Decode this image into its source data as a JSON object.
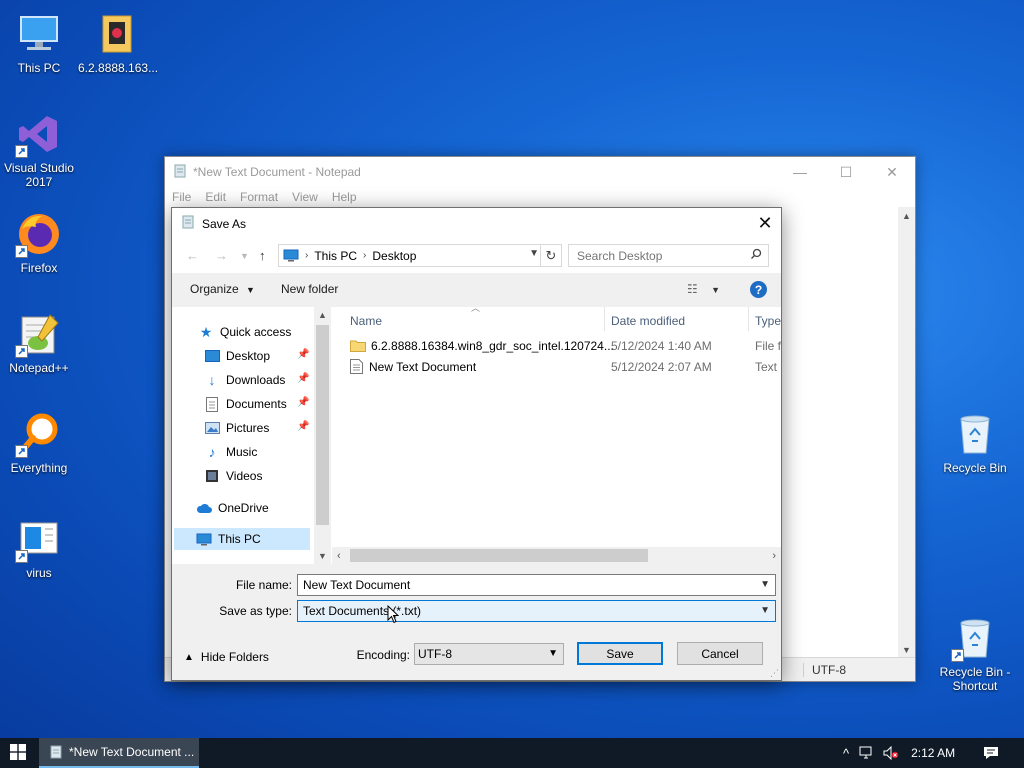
{
  "desktop": {
    "icons": [
      {
        "label": "This PC"
      },
      {
        "label": "6.2.8888.163..."
      },
      {
        "label": "Visual Studio 2017"
      },
      {
        "label": "Firefox"
      },
      {
        "label": "Notepad++"
      },
      {
        "label": "Everything"
      },
      {
        "label": "virus"
      },
      {
        "label": "Recycle Bin"
      },
      {
        "label": "Recycle Bin - Shortcut"
      }
    ]
  },
  "notepad": {
    "title": "*New Text Document - Notepad",
    "menu": [
      "File",
      "Edit",
      "Format",
      "View",
      "Help"
    ],
    "status_encoding": "UTF-8"
  },
  "dialog": {
    "title": "Save As",
    "breadcrumb": [
      "This PC",
      "Desktop"
    ],
    "search_placeholder": "Search Desktop",
    "organize_label": "Organize",
    "new_folder_label": "New folder",
    "nav": {
      "quick_access": "Quick access",
      "desktop": "Desktop",
      "downloads": "Downloads",
      "documents": "Documents",
      "pictures": "Pictures",
      "music": "Music",
      "videos": "Videos",
      "onedrive": "OneDrive",
      "this_pc": "This PC"
    },
    "columns": {
      "name": "Name",
      "date": "Date modified",
      "type": "Type"
    },
    "files": [
      {
        "name": "6.2.8888.16384.win8_gdr_soc_intel.120724...",
        "date": "5/12/2024 1:40 AM",
        "type": "File fo"
      },
      {
        "name": "New Text Document",
        "date": "5/12/2024 2:07 AM",
        "type": "Text D"
      }
    ],
    "file_name_label": "File name:",
    "file_name_value": "New Text Document",
    "save_type_label": "Save as type:",
    "save_type_value": "Text Documents (*.txt)",
    "hide_folders_label": "Hide Folders",
    "encoding_label": "Encoding:",
    "encoding_value": "UTF-8",
    "save_label": "Save",
    "cancel_label": "Cancel"
  },
  "taskbar": {
    "task_label": "*New Text Document ...",
    "clock": "2:12 AM"
  },
  "colors": {
    "accent": "#0078d7",
    "desktop": "#1566d4",
    "taskbar": "#101a27"
  }
}
